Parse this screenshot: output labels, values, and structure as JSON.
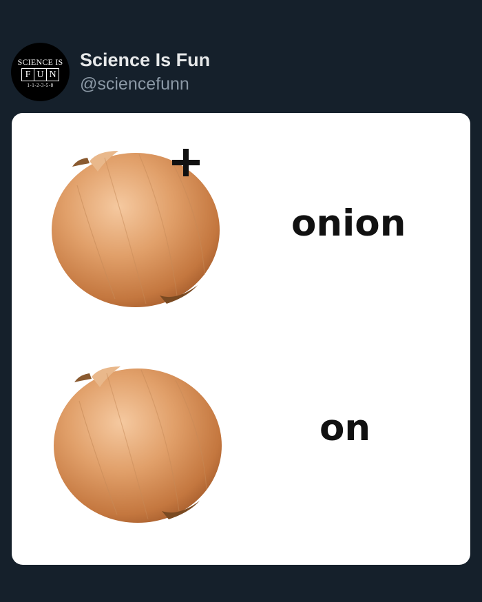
{
  "post": {
    "display_name": "Science Is Fun",
    "handle": "@sciencefunn"
  },
  "avatar": {
    "logo_top": "SCIENCE IS",
    "logo_letters": [
      "F",
      "U",
      "N"
    ],
    "logo_sequence": "1-1-2-3-5-8"
  },
  "meme": {
    "word_top": "onion",
    "word_bottom": "on",
    "plus_symbol": "plus-icon"
  },
  "colors": {
    "background": "#15202b",
    "name_text": "#e7e9ea",
    "handle_text": "#8b98a5",
    "onion": "#d9915e"
  }
}
